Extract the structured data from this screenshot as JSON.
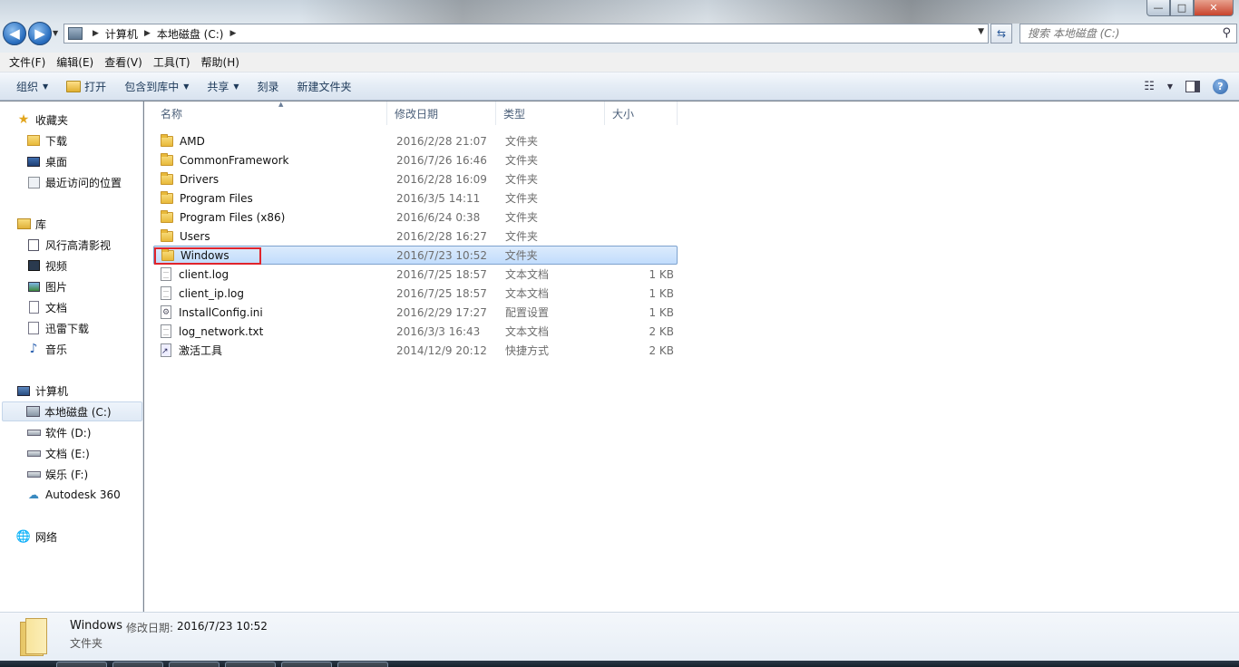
{
  "window": {
    "controls": {
      "minimize": "—",
      "maximize": "□",
      "close": "✕"
    }
  },
  "nav": {
    "back": "◀",
    "forward": "▶"
  },
  "address": {
    "crumbs": [
      "计算机",
      "本地磁盘 (C:)"
    ]
  },
  "search": {
    "placeholder": "搜索 本地磁盘 (C:)"
  },
  "menubar": [
    "文件(F)",
    "编辑(E)",
    "查看(V)",
    "工具(T)",
    "帮助(H)"
  ],
  "toolbar": {
    "organize": "组织",
    "open": "打开",
    "include_library": "包含到库中",
    "share": "共享",
    "burn": "刻录",
    "new_folder": "新建文件夹"
  },
  "navpane": {
    "favorites": {
      "label": "收藏夹",
      "items": [
        "下载",
        "桌面",
        "最近访问的位置"
      ]
    },
    "libraries": {
      "label": "库",
      "items": [
        "风行高清影视",
        "视频",
        "图片",
        "文档",
        "迅雷下载",
        "音乐"
      ]
    },
    "computer": {
      "label": "计算机",
      "items": [
        "本地磁盘 (C:)",
        "软件 (D:)",
        "文档 (E:)",
        "娱乐 (F:)",
        "Autodesk 360"
      ]
    },
    "network": {
      "label": "网络"
    }
  },
  "columns": {
    "name": "名称",
    "modified": "修改日期",
    "type": "类型",
    "size": "大小"
  },
  "files": [
    {
      "name": "AMD",
      "date": "2016/2/28 21:07",
      "type": "文件夹",
      "size": "",
      "icon": "folder-icon"
    },
    {
      "name": "CommonFramework",
      "date": "2016/7/26 16:46",
      "type": "文件夹",
      "size": "",
      "icon": "folder-icon"
    },
    {
      "name": "Drivers",
      "date": "2016/2/28 16:09",
      "type": "文件夹",
      "size": "",
      "icon": "folder-icon"
    },
    {
      "name": "Program Files",
      "date": "2016/3/5 14:11",
      "type": "文件夹",
      "size": "",
      "icon": "folder-icon"
    },
    {
      "name": "Program Files (x86)",
      "date": "2016/6/24 0:38",
      "type": "文件夹",
      "size": "",
      "icon": "folder-icon"
    },
    {
      "name": "Users",
      "date": "2016/2/28 16:27",
      "type": "文件夹",
      "size": "",
      "icon": "folder-icon"
    },
    {
      "name": "Windows",
      "date": "2016/7/23 10:52",
      "type": "文件夹",
      "size": "",
      "icon": "folder-icon",
      "selected": true
    },
    {
      "name": "client.log",
      "date": "2016/7/25 18:57",
      "type": "文本文档",
      "size": "1 KB",
      "icon": "text-file-icon"
    },
    {
      "name": "client_ip.log",
      "date": "2016/7/25 18:57",
      "type": "文本文档",
      "size": "1 KB",
      "icon": "text-file-icon"
    },
    {
      "name": "InstallConfig.ini",
      "date": "2016/2/29 17:27",
      "type": "配置设置",
      "size": "1 KB",
      "icon": "config-file-icon"
    },
    {
      "name": "log_network.txt",
      "date": "2016/3/3 16:43",
      "type": "文本文档",
      "size": "2 KB",
      "icon": "text-file-icon"
    },
    {
      "name": "激活工具",
      "date": "2014/12/9 20:12",
      "type": "快捷方式",
      "size": "2 KB",
      "icon": "shortcut-icon"
    }
  ],
  "details": {
    "name": "Windows",
    "date_label": "修改日期:",
    "date": "2016/7/23 10:52",
    "type": "文件夹"
  }
}
